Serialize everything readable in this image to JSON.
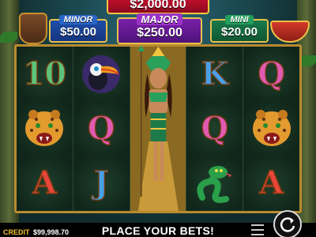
{
  "jackpots": {
    "grand": "$2,000.00",
    "minor_label": "MINOR",
    "minor_value": "$50.00",
    "major_label": "MAJOR",
    "major_value": "$250.00",
    "mini_label": "MINI",
    "mini_value": "$20.00"
  },
  "reels": [
    [
      "10",
      "jaguar",
      "A"
    ],
    [
      "toucan",
      "Q",
      "J"
    ],
    [
      "warrior-queen-wild"
    ],
    [
      "K",
      "Q",
      "snake"
    ],
    [
      "Q",
      "jaguar",
      "A"
    ]
  ],
  "symbols": {
    "r1_top": "10",
    "r1_bottom": "A",
    "r2_mid": "Q",
    "r2_bottom": "J",
    "r4_top": "K",
    "r4_mid": "Q",
    "r5_top": "Q",
    "r5_bottom": "A"
  },
  "footer": {
    "credit_label": "CREDIT",
    "credit_value": "$99,998.70",
    "message": "PLACE YOUR BETS!"
  },
  "colors": {
    "grand": "#c8102e",
    "minor": "#1f4ea8",
    "major": "#7a1fa8",
    "mini": "#1a7a4a",
    "frame_gold": "#b88a2e"
  }
}
